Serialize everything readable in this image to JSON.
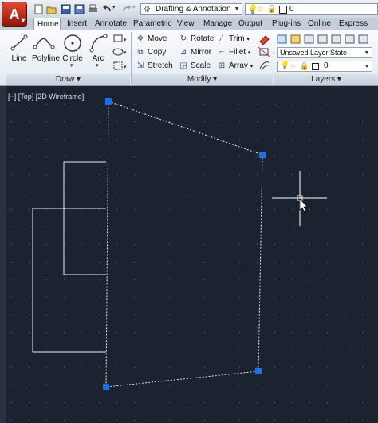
{
  "app": {
    "button_letter": "A",
    "button_sub": "▾"
  },
  "qat": {
    "workspace": "Drafting & Annotation",
    "layer_value": "0"
  },
  "tabs": [
    "Home",
    "Insert",
    "Annotate",
    "Parametric",
    "View",
    "Manage",
    "Output",
    "Plug-ins",
    "Online",
    "Express Tools"
  ],
  "active_tab": "Home",
  "draw": {
    "title": "Draw",
    "tools": [
      "Line",
      "Polyline",
      "Circle",
      "Arc"
    ]
  },
  "modify": {
    "title": "Modify",
    "rows": [
      [
        "Move",
        "Rotate",
        "Trim"
      ],
      [
        "Copy",
        "Mirror",
        "Fillet"
      ],
      [
        "Stretch",
        "Scale",
        "Array"
      ]
    ]
  },
  "layers": {
    "title": "Layers",
    "state": "Unsaved Layer State",
    "current": "0"
  },
  "viewport": {
    "label": "[−] [Top] [2D Wireframe]"
  },
  "colors": {
    "canvas": "#1b2230",
    "grip": "#1f6fe0",
    "geometry": "#ffffff"
  }
}
